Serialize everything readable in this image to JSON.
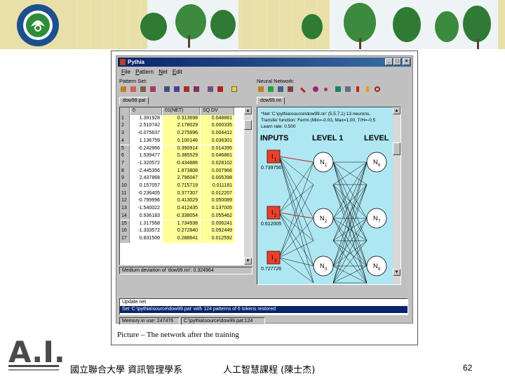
{
  "window": {
    "title": "Pythia",
    "min_btn": "_",
    "max_btn": "□",
    "close_btn": "×"
  },
  "menu": [
    "File",
    "Pattern",
    "Net",
    "Edit"
  ],
  "pattern_set": {
    "label": "Pattern Set:",
    "tab": "dow99.pat",
    "headers": [
      "",
      "0",
      "01(NET)",
      "SQ DV"
    ],
    "rows": [
      [
        "1",
        "1.391928",
        "0.313698",
        "0.048881"
      ],
      [
        "2",
        "2.510742",
        "2.178029",
        "0.000335"
      ],
      [
        "3",
        "-0.075637",
        "0.275696",
        "0.004412"
      ],
      [
        "4",
        "1.136759",
        "0.100146",
        "0.036301"
      ],
      [
        "5",
        "-0.242966",
        "0.390914",
        "0.014395"
      ],
      [
        "6",
        "1.539477",
        "0.385529",
        "0.046881"
      ],
      [
        "7",
        "-1.320572",
        "-0.434886",
        "0.028102"
      ],
      [
        "8",
        "-2.445356",
        "1.973808",
        "0.007966"
      ],
      [
        "9",
        "2.437868",
        "2.796047",
        "0.005398"
      ],
      [
        "10",
        "0.157057",
        "0.715719",
        "0.011181"
      ],
      [
        "11",
        "-0.236405",
        "0.377307",
        "0.012207"
      ],
      [
        "12",
        "-0.799996",
        "0.413029",
        "0.050089"
      ],
      [
        "13",
        "-1.540022",
        "0.412435",
        "0.137005"
      ],
      [
        "14",
        "0.936183",
        "-0.338054",
        "0.055462"
      ],
      [
        "15",
        "1.317568",
        "1.734938",
        "0.006241"
      ],
      [
        "16",
        "-1.333572",
        "0.272840",
        "0.092449"
      ],
      [
        "17",
        "0.831500",
        "0.288641",
        "0.012592"
      ]
    ],
    "status": "Medium deviation of 'dow99.nn': 0.324964"
  },
  "neural_network": {
    "label": "Neural Network:",
    "tab": "dow99.nn",
    "info": [
      "*Net 'C:\\pythia\\source\\dow99.nn' (5,5,7,1) 13 neurons,",
      "Transfer function: Fermi (Min=-0.03, Max=1.00, T/H=-0.5",
      "Learn rate: 0.500"
    ],
    "levels": [
      "INPUTS",
      "LEVEL 1",
      "LEVEL"
    ],
    "inputs": [
      {
        "label": "I",
        "sub": "1",
        "value": "0.739756"
      },
      {
        "label": "I",
        "sub": "2",
        "value": "0.612005"
      },
      {
        "label": "I",
        "sub": "3",
        "value": "0.727726"
      }
    ],
    "level1": [
      {
        "label": "N",
        "sub": "1"
      },
      {
        "label": "N",
        "sub": "2"
      },
      {
        "label": "N",
        "sub": "3"
      }
    ],
    "level2": [
      {
        "label": "N",
        "sub": "6"
      },
      {
        "label": "N",
        "sub": "7"
      },
      {
        "label": "N",
        "sub": "8"
      }
    ]
  },
  "log": {
    "line1": "Update net",
    "line2": "Set 'C:\\pythia\\source\\dow99.pat' with 124 patterns of 6 tokens restored"
  },
  "statusbar": {
    "memory": "Memory in use: 247476",
    "file": "C:\\pythia\\source\\dow99.pat:124"
  },
  "caption": "Picture – The network after the training",
  "footer": {
    "institution": "國立聯合大學 資訊管理學系",
    "course": "人工智慧課程 (陳士杰)",
    "page": "62"
  },
  "colors": {
    "net_background": "#aee7f2",
    "input_node": "#e8402a",
    "highlight_column": "#ffff99",
    "titlebar": "#0a246a"
  }
}
